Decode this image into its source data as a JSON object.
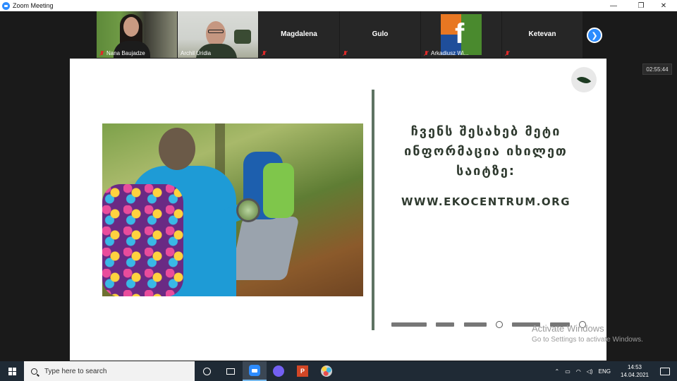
{
  "window": {
    "title": "Zoom Meeting",
    "minimize_glyph": "—",
    "restore_glyph": "❐",
    "close_glyph": "✕"
  },
  "participants": [
    {
      "name": "Nana Baujadze",
      "muted": true,
      "video": true
    },
    {
      "name": "Archil Uridia",
      "muted": false,
      "video": true,
      "active_speaker": true
    },
    {
      "name": "Magdalena",
      "muted": true,
      "video": false
    },
    {
      "name": "Gulo",
      "muted": true,
      "video": false
    },
    {
      "name": "Arkadiusz Wi...",
      "muted": true,
      "video": false,
      "avatar": "f-logo"
    },
    {
      "name": "Ketevan",
      "muted": true,
      "video": false
    }
  ],
  "next_page_glyph": "❯",
  "meeting_timer": "02:55:44",
  "slide": {
    "text_lines": [
      "ჩვენს შესახებ მეტი",
      "ინფორმაცია იხილეთ",
      "საიტზე:"
    ],
    "url": "WWW.EKOCENTRUM.ORG",
    "divider_color": "#5e7363",
    "text_color": "#2f3a2f",
    "badge_icon": "leaf-icon"
  },
  "watermark": {
    "line1": "Activate Windows",
    "line2": "Go to Settings to activate Windows."
  },
  "taskbar": {
    "search_placeholder": "Type here to search",
    "ppt_letter": "P",
    "language": "ENG",
    "time": "14:53",
    "date": "14.04.2021"
  },
  "colors": {
    "zoom_blue": "#2d8cff",
    "active_speaker": "#4cbb38",
    "muted_red": "#e02828",
    "taskbar": "#1f2a35"
  }
}
